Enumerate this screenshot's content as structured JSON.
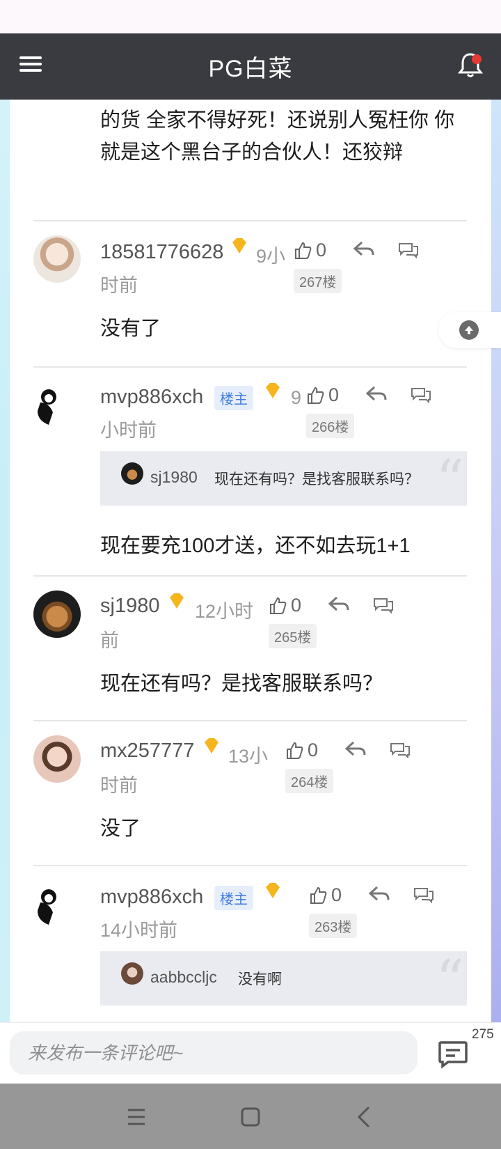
{
  "header": {
    "title": "PG白菜"
  },
  "cont_text": "的货 全家不得好死！还说别人冤枉你 你就是这个黑台子的合伙人！还狡辩",
  "comments": [
    {
      "username": "18581776628",
      "time_a": "9小",
      "time_b": "时前",
      "likes": "0",
      "floor": "267楼",
      "text": "没有了"
    },
    {
      "username": "mvp886xch",
      "host": "楼主",
      "time_a": "9",
      "time_b": "小时前",
      "likes": "0",
      "floor": "266楼",
      "quote": {
        "name": "sj1980",
        "text": "现在还有吗？是找客服联系吗？"
      },
      "text": "现在要充100才送，还不如去玩1+1"
    },
    {
      "username": "sj1980",
      "time_a": "12小时",
      "time_b": "前",
      "likes": "0",
      "floor": "265楼",
      "text": "现在还有吗？是找客服联系吗？"
    },
    {
      "username": "mx257777",
      "time_a": "13小",
      "time_b": "时前",
      "likes": "0",
      "floor": "264楼",
      "text": "没了"
    },
    {
      "username": "mvp886xch",
      "host": "楼主",
      "time_b": "14小时前",
      "likes": "0",
      "floor": "263楼",
      "quote": {
        "name": "aabbccljc",
        "text": "没有啊"
      }
    }
  ],
  "bottom": {
    "placeholder": "来发布一条评论吧~",
    "count": "275"
  },
  "icons": [
    "menu-icon",
    "bell-icon",
    "thumbs-up-icon",
    "reply-icon",
    "comment-icon",
    "arrow-up-icon",
    "nav-menu-icon",
    "nav-home-icon",
    "nav-back-icon"
  ]
}
